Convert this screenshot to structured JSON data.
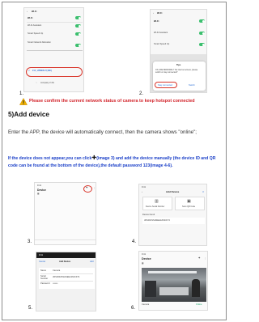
{
  "shots": {
    "s1": {
      "number": "1.",
      "header": "Wi-Fi",
      "wifi_label": "Wi-Fi",
      "assistant_label": "Wi-Fi Assistant",
      "speed_label": "Smart Speed Up",
      "alloc_label": "Smart Network Allocation",
      "network_name": "Z-K_HTMCN Y(16C)",
      "other_network": "company 2.4G"
    },
    "s2": {
      "number": "2.",
      "header": "Wi-Fi",
      "wifi_label": "Wi-Fi",
      "assistant_label": "Wi-Fi Assistant",
      "speed_label": "Smart Speed Up",
      "dialog_title": "Tips",
      "dialog_text": "XX-CAM-5D9F0062-7 No internet access, please switch or stay connected?",
      "btn_left": "Stay connected",
      "btn_right": "Switch"
    },
    "s3": {
      "number": "3.",
      "time": "9:41",
      "title": "Device"
    },
    "s4": {
      "number": "4.",
      "time": "9:41",
      "title": "Add Device",
      "opt1": "Device Serial Number",
      "opt2": "Scan QR Code",
      "section": "Device found",
      "found": "JRS001SSHSEE1264CF74"
    },
    "s5": {
      "number": "5.",
      "time": "9:41",
      "cancel": "Cancel",
      "title": "Add Device",
      "add": "Add",
      "name_label": "Name",
      "name_value": "Camera",
      "serial_label": "Serial Number",
      "serial_value": "JRS0002SSHSEE1264CF74",
      "pwd_label": "Password",
      "pwd_value": "•••••••"
    },
    "s6": {
      "number": "6.",
      "time": "9:41",
      "title": "Device",
      "cam_label": "Camera",
      "status": "Online"
    }
  },
  "warning": "Please confirm the current network status of camera to keep hotspot connected",
  "section_heading": "5)Add device",
  "body_text": "Enter the APP, the device will automatically connect, then the camera shows \"online\";",
  "note_before_plus": "If the device does not appear,you can click",
  "note_plus": "✚",
  "note_after_plus": "(image 3) and add the device manually (the device ID and QR code can be found at the bottom of the device),the default password 123(image 4-6).",
  "colors": {
    "warning": "#d2232a",
    "note": "#1a3fc8",
    "switch_on": "#3bbf6e",
    "accent_blue": "#2b6fd6"
  }
}
